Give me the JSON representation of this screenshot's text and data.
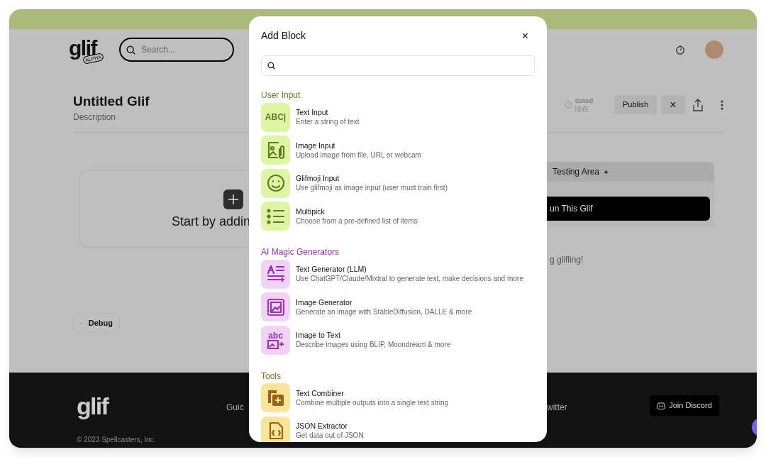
{
  "header": {
    "logo": "glif",
    "logo_badge": "ALPHA",
    "search": {
      "placeholder": "Search..."
    }
  },
  "editor": {
    "title": "Untitled Glif",
    "description": "Description",
    "saved_label": "Saved",
    "saved_time": "現在",
    "publish": "Publish",
    "close": "×"
  },
  "canvas": {
    "prompt": "Start by addin",
    "debug": "Debug"
  },
  "testing_area": {
    "title": "Testing Area",
    "run_button": "un This Glif",
    "message": "g glifling!"
  },
  "footer": {
    "logo": "glif",
    "links": [
      "Guic",
      "witter"
    ],
    "discord": "Join Discord",
    "copyright": "© 2023 Spellcasters, Inc."
  },
  "modal": {
    "title": "Add Block",
    "close": "×",
    "sections": [
      {
        "title": "User Input",
        "color": "#5f7d1f",
        "items": [
          {
            "kind": "text-input",
            "icon_text": "ABC|",
            "title": "Text Input",
            "description": "Enter a string of text"
          },
          {
            "kind": "image-input",
            "title": "Image Input",
            "description": "Upload image from file, URL or webcam"
          },
          {
            "kind": "glifmoji",
            "title": "Glifmoji Input",
            "description": "Use glifmoji as image input (user must train first)"
          },
          {
            "kind": "multipick",
            "title": "Multipick",
            "description": "Choose from a pre-defined list of items"
          }
        ]
      },
      {
        "title": "AI Magic Generators",
        "color": "#9c2fb8",
        "items": [
          {
            "kind": "text-generator",
            "title": "Text Generator (LLM)",
            "description": "Use ChatGPT/Claude/Mixtral to generate text, make decisions and more"
          },
          {
            "kind": "image-generator",
            "title": "Image Generator",
            "description": "Generate an image with StableDiffusion, DALLE & more"
          },
          {
            "kind": "image-to-text",
            "icon_text": "abc",
            "title": "Image to Text",
            "description": "Describe images using BLIP, Moondream & more"
          }
        ]
      },
      {
        "title": "Tools",
        "color": "#9a6416",
        "items": [
          {
            "kind": "text-combiner",
            "title": "Text Combiner",
            "description": "Combine multiple outputs into a single text string"
          },
          {
            "kind": "json-extractor",
            "title": "JSON Extractor",
            "description": "Get data out of JSON"
          }
        ]
      }
    ]
  }
}
